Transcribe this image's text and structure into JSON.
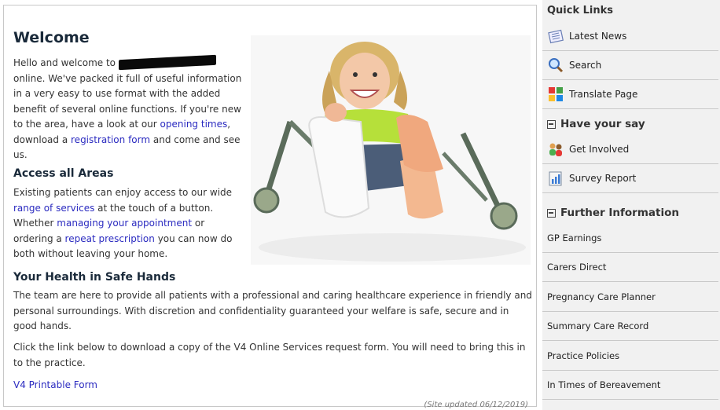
{
  "main": {
    "title": "Welcome",
    "intro": {
      "part1": "Hello and welcome to ",
      "part2": " online.  We've packed it full of useful information in a very easy to use format with the added benefit of several online functions. If you're new to the area, have a look at our ",
      "link_opening": "opening times",
      "part3": ", download a ",
      "link_registration": "registration form",
      "part4": " and come and see us."
    },
    "access": {
      "heading": "Access all Areas",
      "part1": "Existing patients can enjoy access to our wide ",
      "link_services": "range of services",
      "part2": " at the touch of a button. Whether ",
      "link_appointment": "managing your appointment",
      "part3": " or ordering a ",
      "link_prescription": "repeat prescription",
      "part4": " you can now do both without leaving your home."
    },
    "health": {
      "heading": "Your Health in Safe Hands",
      "para1": "The team are here to provide all patients with a professional and caring healthcare experience in friendly and personal surroundings. With discretion and confidentiality guaranteed your welfare is safe, secure and in good hands.",
      "para2": "Click the link below to download a copy of the V4 Online Services request form. You will need to bring this in to the practice.",
      "link_form": "V4 Printable Form"
    },
    "updated": "(Site updated 06/12/2019)"
  },
  "sidebar": {
    "quick_links_title": "Quick Links",
    "quick_links": [
      {
        "label": "Latest News",
        "icon": "newspaper-icon"
      },
      {
        "label": "Search",
        "icon": "magnifier-icon"
      },
      {
        "label": "Translate Page",
        "icon": "translate-icon"
      }
    ],
    "have_your_say_title": "Have your say",
    "have_your_say": [
      {
        "label": "Get Involved",
        "icon": "people-icon"
      },
      {
        "label": "Survey Report",
        "icon": "report-icon"
      }
    ],
    "further_title": "Further Information",
    "further": [
      {
        "label": "GP Earnings"
      },
      {
        "label": "Carers Direct"
      },
      {
        "label": "Pregnancy Care Planner"
      },
      {
        "label": "Summary Care Record"
      },
      {
        "label": "Practice Policies"
      },
      {
        "label": "In Times of Bereavement"
      }
    ]
  },
  "colors": {
    "link": "#2b2bc0",
    "sidebar_bg": "#f1f1f1",
    "heading": "#1a2a3a"
  }
}
